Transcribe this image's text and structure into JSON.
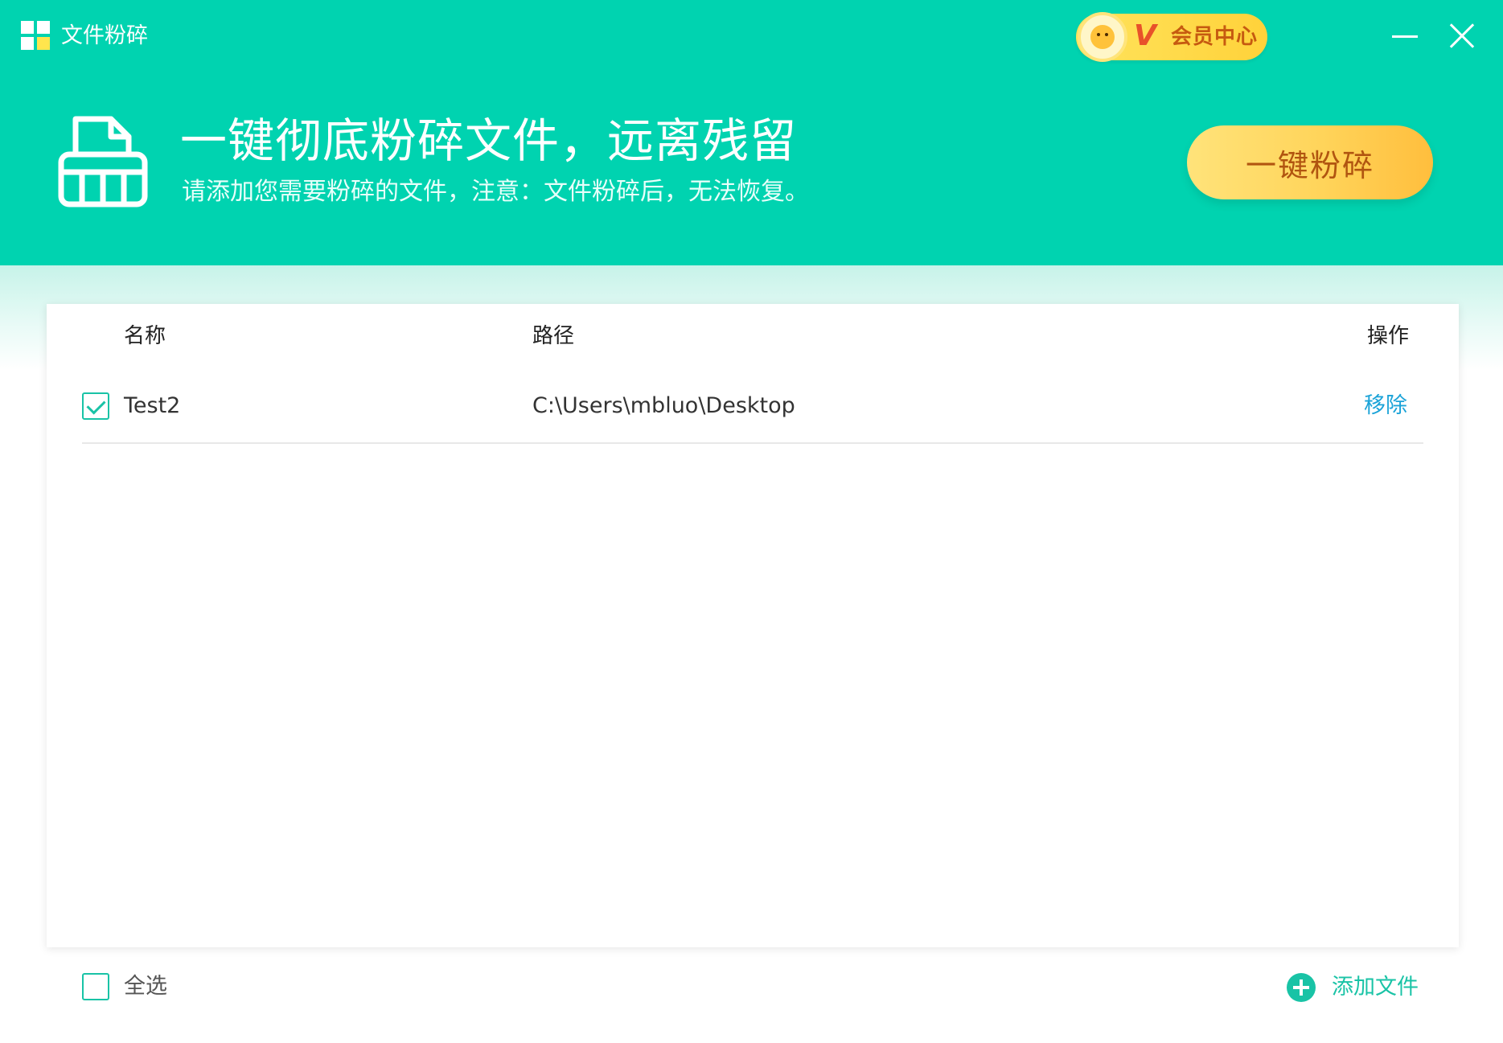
{
  "titlebar": {
    "app_title": "文件粉碎",
    "vip_badge": {
      "v_label": "V",
      "label": "会员中心"
    }
  },
  "hero": {
    "headline": "一键彻底粉碎文件，远离残留",
    "subline": "请添加您需要粉碎的文件，注意：文件粉碎后，无法恢复。",
    "shred_button_label": "一键粉碎"
  },
  "table": {
    "columns": {
      "name": "名称",
      "path": "路径",
      "action": "操作"
    },
    "rows": [
      {
        "name": "Test2",
        "path": "C:\\Users\\mbluo\\Desktop",
        "action_label": "移除",
        "checked": true
      }
    ]
  },
  "footer": {
    "select_all_label": "全选",
    "add_file_label": "添加文件"
  },
  "colors": {
    "header_bg": "#00d3b0",
    "accent": "#19c3a6",
    "link": "#1ba3d8",
    "shred_button": "#ffd45a",
    "vip_badge": "#ffd23a"
  },
  "icons": {
    "app_icon": "windows-grid-icon",
    "hero_icon": "shredder-icon",
    "minimize": "minimize-icon",
    "close": "close-icon",
    "add": "plus-circle-icon",
    "vip_avatar": "vip-face-icon"
  }
}
